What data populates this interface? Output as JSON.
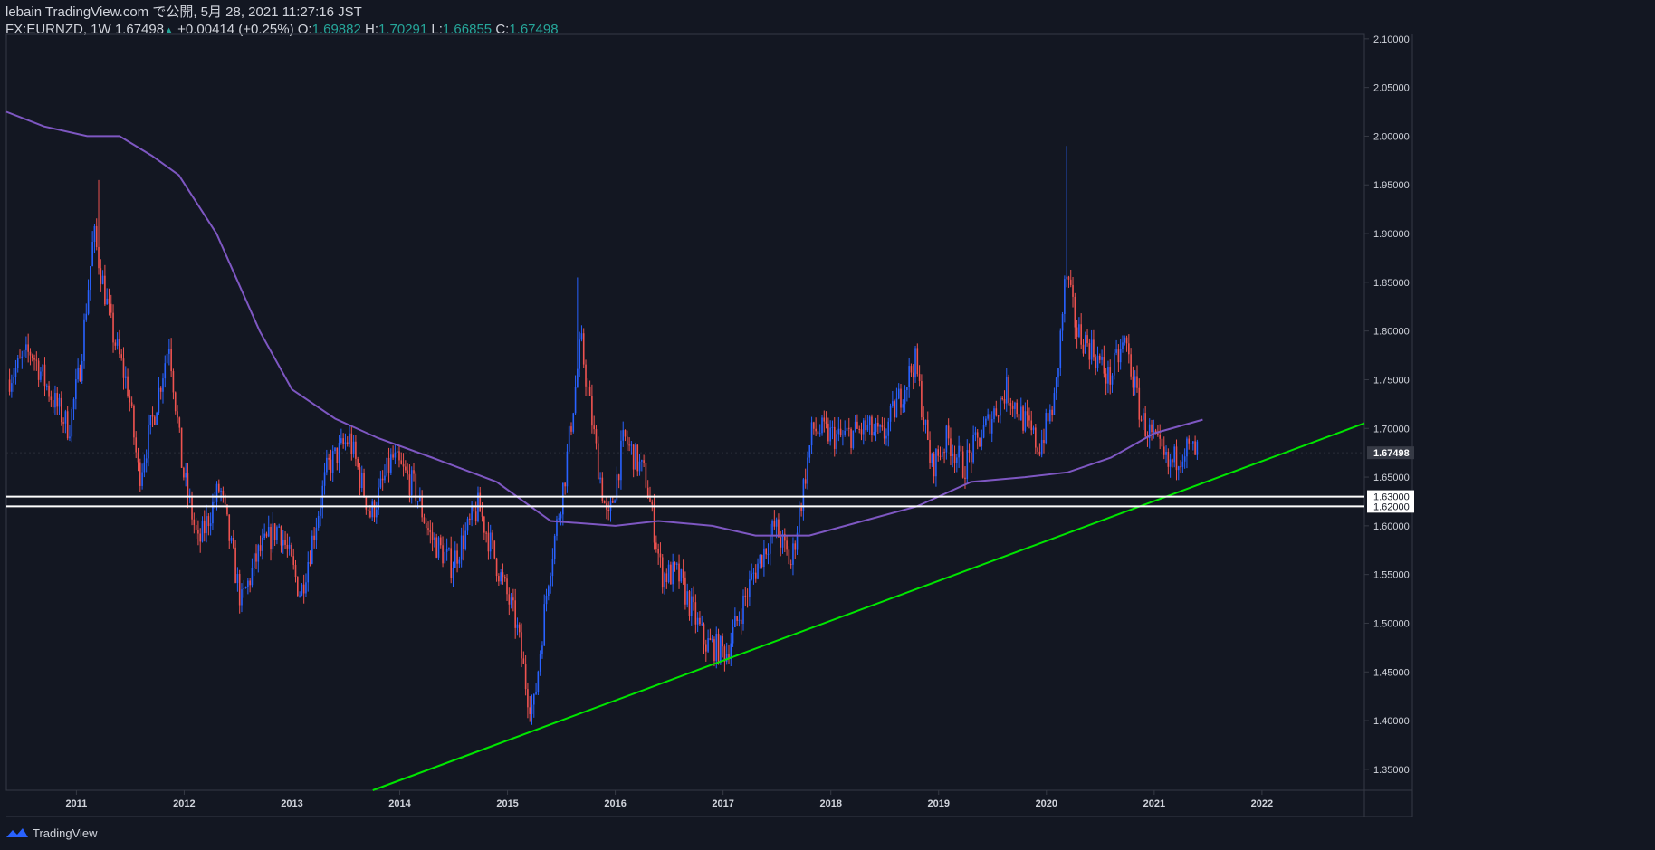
{
  "header": {
    "line1": "lebain TradingView.com で公開, 5月 28, 2021 11:27:16 JST",
    "symbol": "FX:EURNZD, 1W",
    "last": "1.67498",
    "up_glyph": "▲",
    "change": "+0.00414 (+0.25%)",
    "o_label": "O:",
    "o_value": "1.69882",
    "h_label": "H:",
    "h_value": "1.70291",
    "l_label": "L:",
    "l_value": "1.66855",
    "c_label": "C:",
    "c_value": "1.67498"
  },
  "footer": {
    "brand": "TradingView",
    "logo_icon": "tradingview-logo-icon"
  },
  "colors": {
    "background": "#131722",
    "up": "#2962ff",
    "down": "#ef5350",
    "ma": "#7e57c2",
    "trendline": "#00e600",
    "hline": "#ffffff",
    "axis_text": "#d1d4dc",
    "border": "#363a45"
  },
  "chart_data": {
    "type": "candlestick",
    "symbol": "FX:EURNZD",
    "timeframe": "1W",
    "x_ticks": [
      "2011",
      "2012",
      "2013",
      "2014",
      "2015",
      "2016",
      "2017",
      "2018",
      "2019",
      "2020",
      "2021",
      "2022"
    ],
    "y_ticks": [
      "1.35000",
      "1.40000",
      "1.45000",
      "1.50000",
      "1.55000",
      "1.60000",
      "1.65000",
      "1.70000",
      "1.75000",
      "1.80000",
      "1.85000",
      "1.90000",
      "1.95000",
      "2.00000",
      "2.05000",
      "2.10000"
    ],
    "xlim": [
      2010.35,
      2022.95
    ],
    "ylim": [
      1.3285,
      2.1045
    ],
    "price_path": [
      [
        2010.38,
        1.75
      ],
      [
        2010.6,
        1.78
      ],
      [
        2010.8,
        1.73
      ],
      [
        2010.95,
        1.7
      ],
      [
        2011.05,
        1.76
      ],
      [
        2011.18,
        1.9
      ],
      [
        2011.35,
        1.8
      ],
      [
        2011.5,
        1.74
      ],
      [
        2011.6,
        1.65
      ],
      [
        2011.75,
        1.72
      ],
      [
        2011.88,
        1.79
      ],
      [
        2012.0,
        1.66
      ],
      [
        2012.15,
        1.58
      ],
      [
        2012.35,
        1.64
      ],
      [
        2012.45,
        1.58
      ],
      [
        2012.55,
        1.52
      ],
      [
        2012.7,
        1.57
      ],
      [
        2012.9,
        1.6
      ],
      [
        2013.1,
        1.53
      ],
      [
        2013.35,
        1.66
      ],
      [
        2013.55,
        1.69
      ],
      [
        2013.75,
        1.61
      ],
      [
        2013.95,
        1.67
      ],
      [
        2014.15,
        1.64
      ],
      [
        2014.3,
        1.59
      ],
      [
        2014.5,
        1.56
      ],
      [
        2014.75,
        1.62
      ],
      [
        2014.95,
        1.55
      ],
      [
        2015.1,
        1.5
      ],
      [
        2015.2,
        1.43
      ],
      [
        2015.26,
        1.41
      ],
      [
        2015.4,
        1.55
      ],
      [
        2015.55,
        1.65
      ],
      [
        2015.7,
        1.79
      ],
      [
        2015.85,
        1.67
      ],
      [
        2015.95,
        1.6
      ],
      [
        2016.1,
        1.69
      ],
      [
        2016.3,
        1.65
      ],
      [
        2016.45,
        1.55
      ],
      [
        2016.6,
        1.55
      ],
      [
        2016.85,
        1.48
      ],
      [
        2017.05,
        1.47
      ],
      [
        2017.3,
        1.55
      ],
      [
        2017.5,
        1.6
      ],
      [
        2017.65,
        1.56
      ],
      [
        2017.85,
        1.7
      ],
      [
        2018.1,
        1.69
      ],
      [
        2018.35,
        1.7
      ],
      [
        2018.5,
        1.69
      ],
      [
        2018.65,
        1.73
      ],
      [
        2018.8,
        1.77
      ],
      [
        2018.95,
        1.66
      ],
      [
        2019.1,
        1.69
      ],
      [
        2019.25,
        1.66
      ],
      [
        2019.45,
        1.7
      ],
      [
        2019.65,
        1.74
      ],
      [
        2019.8,
        1.71
      ],
      [
        2019.95,
        1.68
      ],
      [
        2020.1,
        1.73
      ],
      [
        2020.2,
        1.86
      ],
      [
        2020.3,
        1.8
      ],
      [
        2020.45,
        1.78
      ],
      [
        2020.6,
        1.75
      ],
      [
        2020.75,
        1.79
      ],
      [
        2020.9,
        1.71
      ],
      [
        2021.0,
        1.69
      ],
      [
        2021.15,
        1.66
      ],
      [
        2021.3,
        1.68
      ],
      [
        2021.41,
        1.675
      ]
    ],
    "notable_extremes": [
      {
        "x": 2011.2,
        "high": 1.955
      },
      {
        "x": 2015.25,
        "low": 1.403
      },
      {
        "x": 2015.65,
        "high": 1.855
      },
      {
        "x": 2020.19,
        "high": 1.99
      }
    ],
    "moving_average": [
      [
        2010.35,
        2.025
      ],
      [
        2010.7,
        2.01
      ],
      [
        2011.1,
        2.0
      ],
      [
        2011.4,
        2.0
      ],
      [
        2011.7,
        1.98
      ],
      [
        2011.95,
        1.96
      ],
      [
        2012.3,
        1.9
      ],
      [
        2012.7,
        1.8
      ],
      [
        2013.0,
        1.74
      ],
      [
        2013.4,
        1.71
      ],
      [
        2013.8,
        1.69
      ],
      [
        2014.3,
        1.67
      ],
      [
        2014.9,
        1.645
      ],
      [
        2015.4,
        1.605
      ],
      [
        2016.0,
        1.6
      ],
      [
        2016.4,
        1.605
      ],
      [
        2016.9,
        1.6
      ],
      [
        2017.3,
        1.59
      ],
      [
        2017.8,
        1.59
      ],
      [
        2018.3,
        1.605
      ],
      [
        2018.8,
        1.62
      ],
      [
        2019.3,
        1.645
      ],
      [
        2019.8,
        1.65
      ],
      [
        2020.2,
        1.655
      ],
      [
        2020.6,
        1.67
      ],
      [
        2021.0,
        1.695
      ],
      [
        2021.45,
        1.709
      ]
    ],
    "trendline": {
      "x1": 2013.75,
      "y1": 1.3285,
      "x2": 2022.95,
      "y2": 1.7053
    },
    "hlines": [
      {
        "value": 1.63,
        "label": "1.63000"
      },
      {
        "value": 1.62,
        "label": "1.62000"
      }
    ],
    "last_price": {
      "value": 1.67498,
      "label": "1.67498"
    }
  }
}
